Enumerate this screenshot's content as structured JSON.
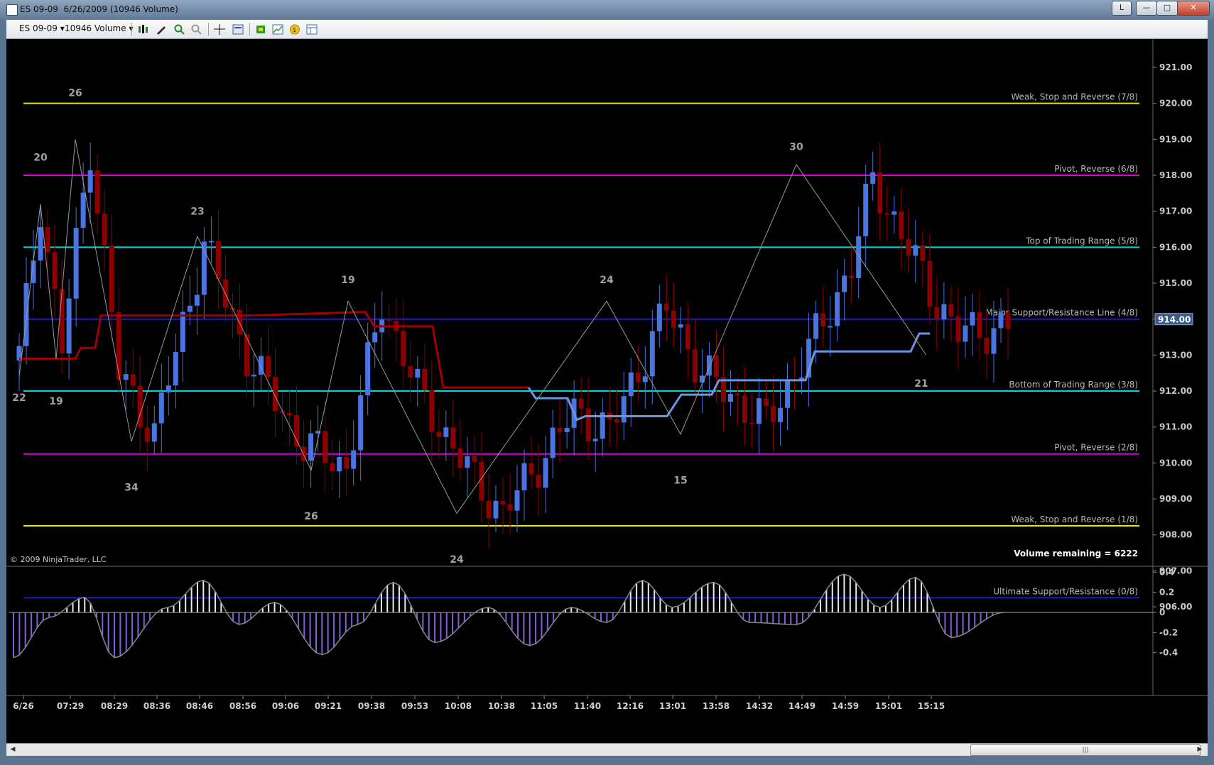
{
  "window": {
    "title": "ES 09-09  6/26/2009 (10946 Volume)",
    "buttons": {
      "link": "L",
      "minimize": "—",
      "maximize": "□",
      "close": "✕"
    }
  },
  "toolbar": {
    "instrument": "ES 09-09",
    "interval": "10946 Volume",
    "icons": [
      "bar-style-icon",
      "draw-tool-icon",
      "zoom-in-icon",
      "zoom-out-icon",
      "crosshair-icon",
      "properties-icon",
      "strategy-icon",
      "indicator-icon",
      "coin-icon",
      "data-box-icon"
    ]
  },
  "price_panel": {
    "copyright": "© 2009 NinjaTrader, LLC",
    "volume_remaining": "Volume remaining = 6222",
    "current_price": "914.00",
    "y_ticks": [
      "921.00",
      "920.00",
      "919.00",
      "918.00",
      "917.00",
      "916.00",
      "915.00",
      "914.00",
      "913.00",
      "912.00",
      "911.00",
      "910.00",
      "909.00",
      "908.00",
      "907.00",
      "906.00"
    ],
    "murrey_lines": [
      {
        "label": "Weak, Stop and Reverse (7/8)",
        "price": 920.0,
        "color": "#e6e600"
      },
      {
        "label": "Pivot, Reverse (6/8)",
        "price": 918.0,
        "color": "#e000e0"
      },
      {
        "label": "Top of Trading Range (5/8)",
        "price": 916.0,
        "color": "#00d8d8"
      },
      {
        "label": "Major Support/Resistance Line (4/8)",
        "price": 914.0,
        "color": "#1c1cc8"
      },
      {
        "label": "Bottom of Trading Range (3/8)",
        "price": 912.0,
        "color": "#00d8d8"
      },
      {
        "label": "Pivot, Reverse (2/8)",
        "price": 910.25,
        "color": "#e000e0"
      },
      {
        "label": "Weak, Stop and Reverse (1/8)",
        "price": 908.25,
        "color": "#e6e600"
      },
      {
        "label": "Ultimate Support/Resistance (0/8)",
        "price": 906.25,
        "color": "#1c1cc8"
      }
    ],
    "swing_labels": [
      "22",
      "20",
      "19",
      "26",
      "34",
      "23",
      "26",
      "19",
      "24",
      "24",
      "15",
      "30",
      "21"
    ]
  },
  "oscillator_panel": {
    "y_ticks": [
      "0.4",
      "0.2",
      "0",
      "-0.2",
      "-0.4"
    ]
  },
  "x_axis": {
    "labels": [
      "6/26",
      "07:29",
      "08:29",
      "08:36",
      "08:46",
      "08:56",
      "09:06",
      "09:21",
      "09:38",
      "09:53",
      "10:08",
      "10:38",
      "11:05",
      "11:40",
      "12:16",
      "13:01",
      "13:58",
      "14:32",
      "14:49",
      "14:59",
      "15:01",
      "15:15"
    ]
  },
  "colors": {
    "up_candle": "#4a74e0",
    "down_candle": "#8b0000",
    "trail_red": "#a00000",
    "trail_blue": "#6a96e0",
    "osc_pos": "#e8e8f0",
    "osc_neg": "#8060d8"
  }
}
